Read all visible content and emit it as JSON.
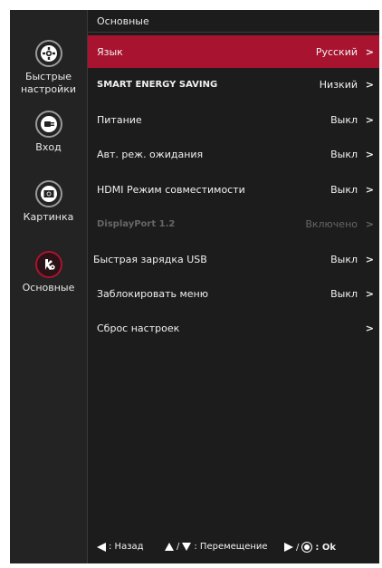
{
  "colors": {
    "accent": "#a8142f",
    "background": "#1c1c1c",
    "sidebar": "#232323"
  },
  "sidebar": {
    "items": [
      {
        "label": "Быстрые настройки",
        "icon": "gear-icon"
      },
      {
        "label": "Вход",
        "icon": "input-plug-icon"
      },
      {
        "label": "Картинка",
        "icon": "picture-icon"
      },
      {
        "label": "Основные",
        "icon": "general-settings-icon"
      }
    ]
  },
  "main": {
    "section_title": "Основные",
    "rows": [
      {
        "label": "Язык",
        "value": "Русский",
        "chevron": ">"
      },
      {
        "label": "SMART ENERGY SAVING",
        "value": "Низкий",
        "chevron": ">"
      },
      {
        "label": "Питание",
        "value": "Выкл",
        "chevron": ">"
      },
      {
        "label": "Авт. реж. ожидания",
        "value": "Выкл",
        "chevron": ">"
      },
      {
        "label": "HDMI Режим совместимости",
        "value": "Выкл",
        "chevron": ">"
      },
      {
        "label": "DisplayPort 1.2",
        "value": "Включено",
        "chevron": ">"
      },
      {
        "label": "Быстрая зарядка USB",
        "value": "Выкл",
        "chevron": ">"
      },
      {
        "label": "Заблокировать меню",
        "value": "Выкл",
        "chevron": ">"
      },
      {
        "label": "Сброс настроек",
        "value": "",
        "chevron": ">"
      }
    ]
  },
  "footer": {
    "back": ": Назад",
    "slash": "/",
    "move": ": Перемещение",
    "ok": ": Ok"
  }
}
